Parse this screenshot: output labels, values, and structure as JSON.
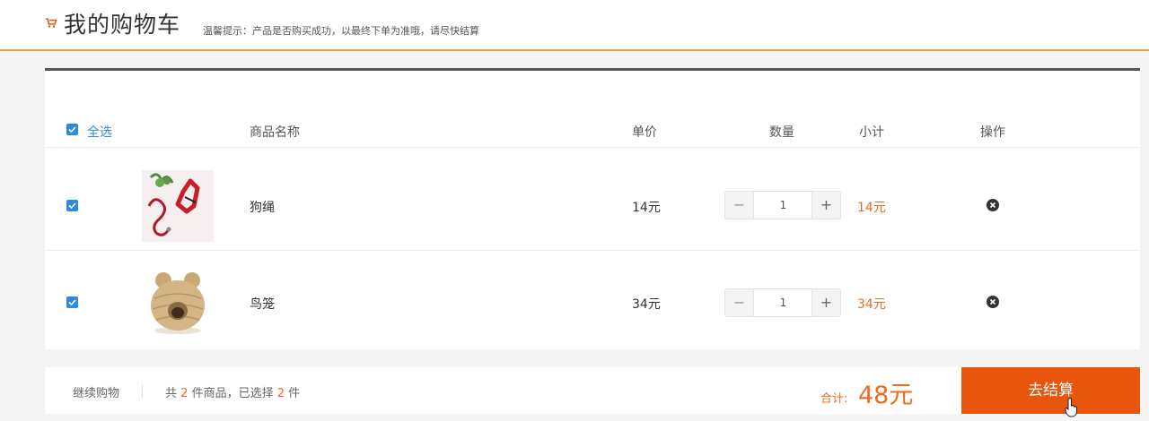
{
  "header": {
    "title": "我的购物车",
    "tip": "温馨提示：产品是否购买成功，以最终下单为准哦，请尽快结算"
  },
  "table": {
    "select_all": "全选",
    "columns": {
      "name": "商品名称",
      "price": "单价",
      "quantity": "数量",
      "subtotal": "小计",
      "action": "操作"
    }
  },
  "items": [
    {
      "name": "狗绳",
      "price": "14元",
      "quantity": "1",
      "subtotal": "14元",
      "checked": true,
      "image": "dog-leash"
    },
    {
      "name": "鸟笼",
      "price": "34元",
      "quantity": "1",
      "subtotal": "34元",
      "checked": true,
      "image": "bird-cage"
    }
  ],
  "stepper": {
    "minus": "−",
    "plus": "+"
  },
  "footer": {
    "continue": "继续购物",
    "summary_prefix": "共",
    "total_count": "2",
    "summary_mid": "件商品，已选择",
    "selected_count": "2",
    "summary_suffix": "件",
    "total_label": "合计:",
    "total_value": "48元",
    "checkout": "去结算"
  },
  "colors": {
    "accent": "#f06a1e",
    "checkout_bg": "#e8560e",
    "checkbox": "#2e8ade",
    "header_border": "#f0a03c"
  }
}
